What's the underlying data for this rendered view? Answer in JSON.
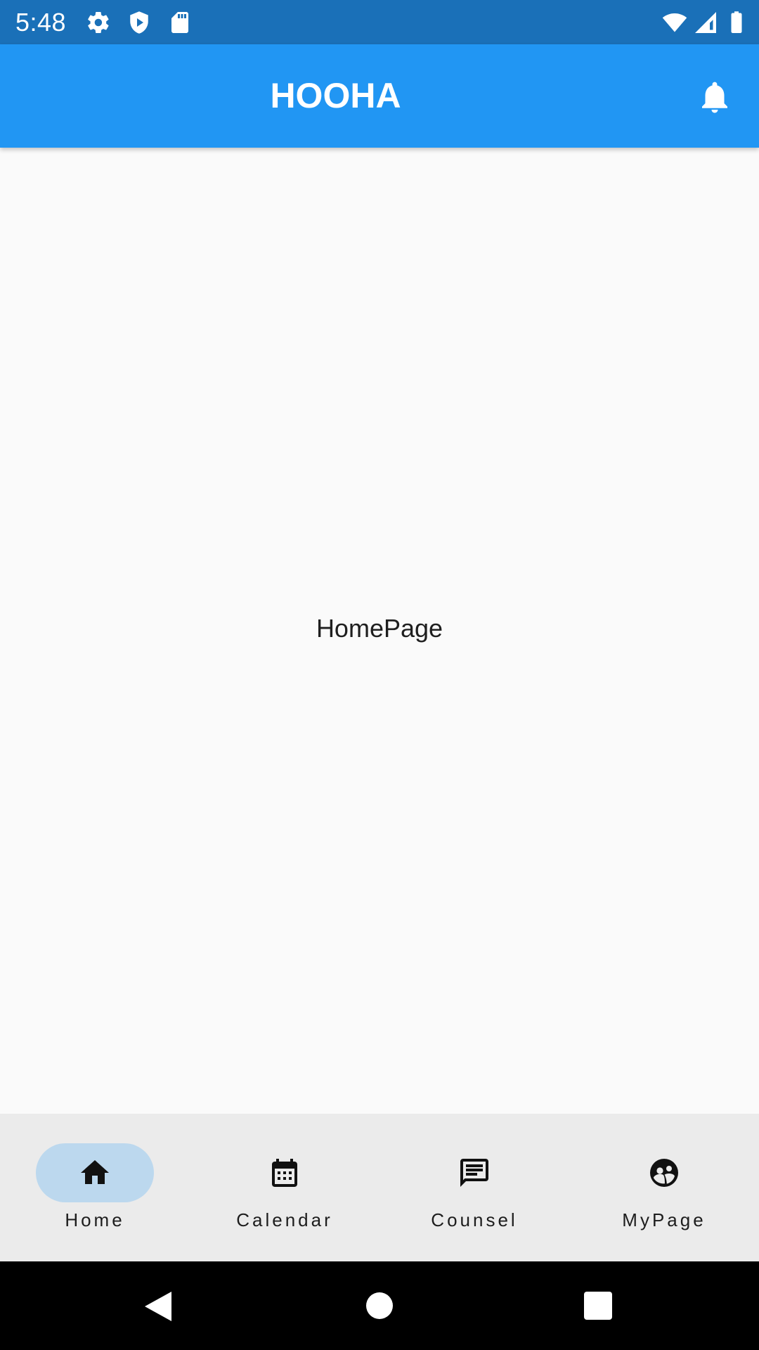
{
  "status_bar": {
    "time": "5:48",
    "icons": [
      "gear-icon",
      "shield-play-icon",
      "sd-card-icon",
      "wifi-icon",
      "cell-signal-icon",
      "battery-icon"
    ]
  },
  "app_bar": {
    "title": "HOOHA",
    "action_icon": "bell-icon"
  },
  "main": {
    "content_text": "HomePage"
  },
  "bottom_nav": {
    "items": [
      {
        "label": "Home",
        "icon": "home-icon",
        "selected": true
      },
      {
        "label": "Calendar",
        "icon": "calendar-icon",
        "selected": false
      },
      {
        "label": "Counsel",
        "icon": "chat-icon",
        "selected": false
      },
      {
        "label": "MyPage",
        "icon": "people-icon",
        "selected": false
      }
    ]
  },
  "system_nav": {
    "buttons": [
      "back-icon",
      "home-circle-icon",
      "recents-icon"
    ]
  },
  "colors": {
    "status_bar": "#1a70b8",
    "app_bar": "#2196f3",
    "background": "#fafafa",
    "bottom_nav": "#ebebeb",
    "selected_pill": "#bcd8ee"
  }
}
